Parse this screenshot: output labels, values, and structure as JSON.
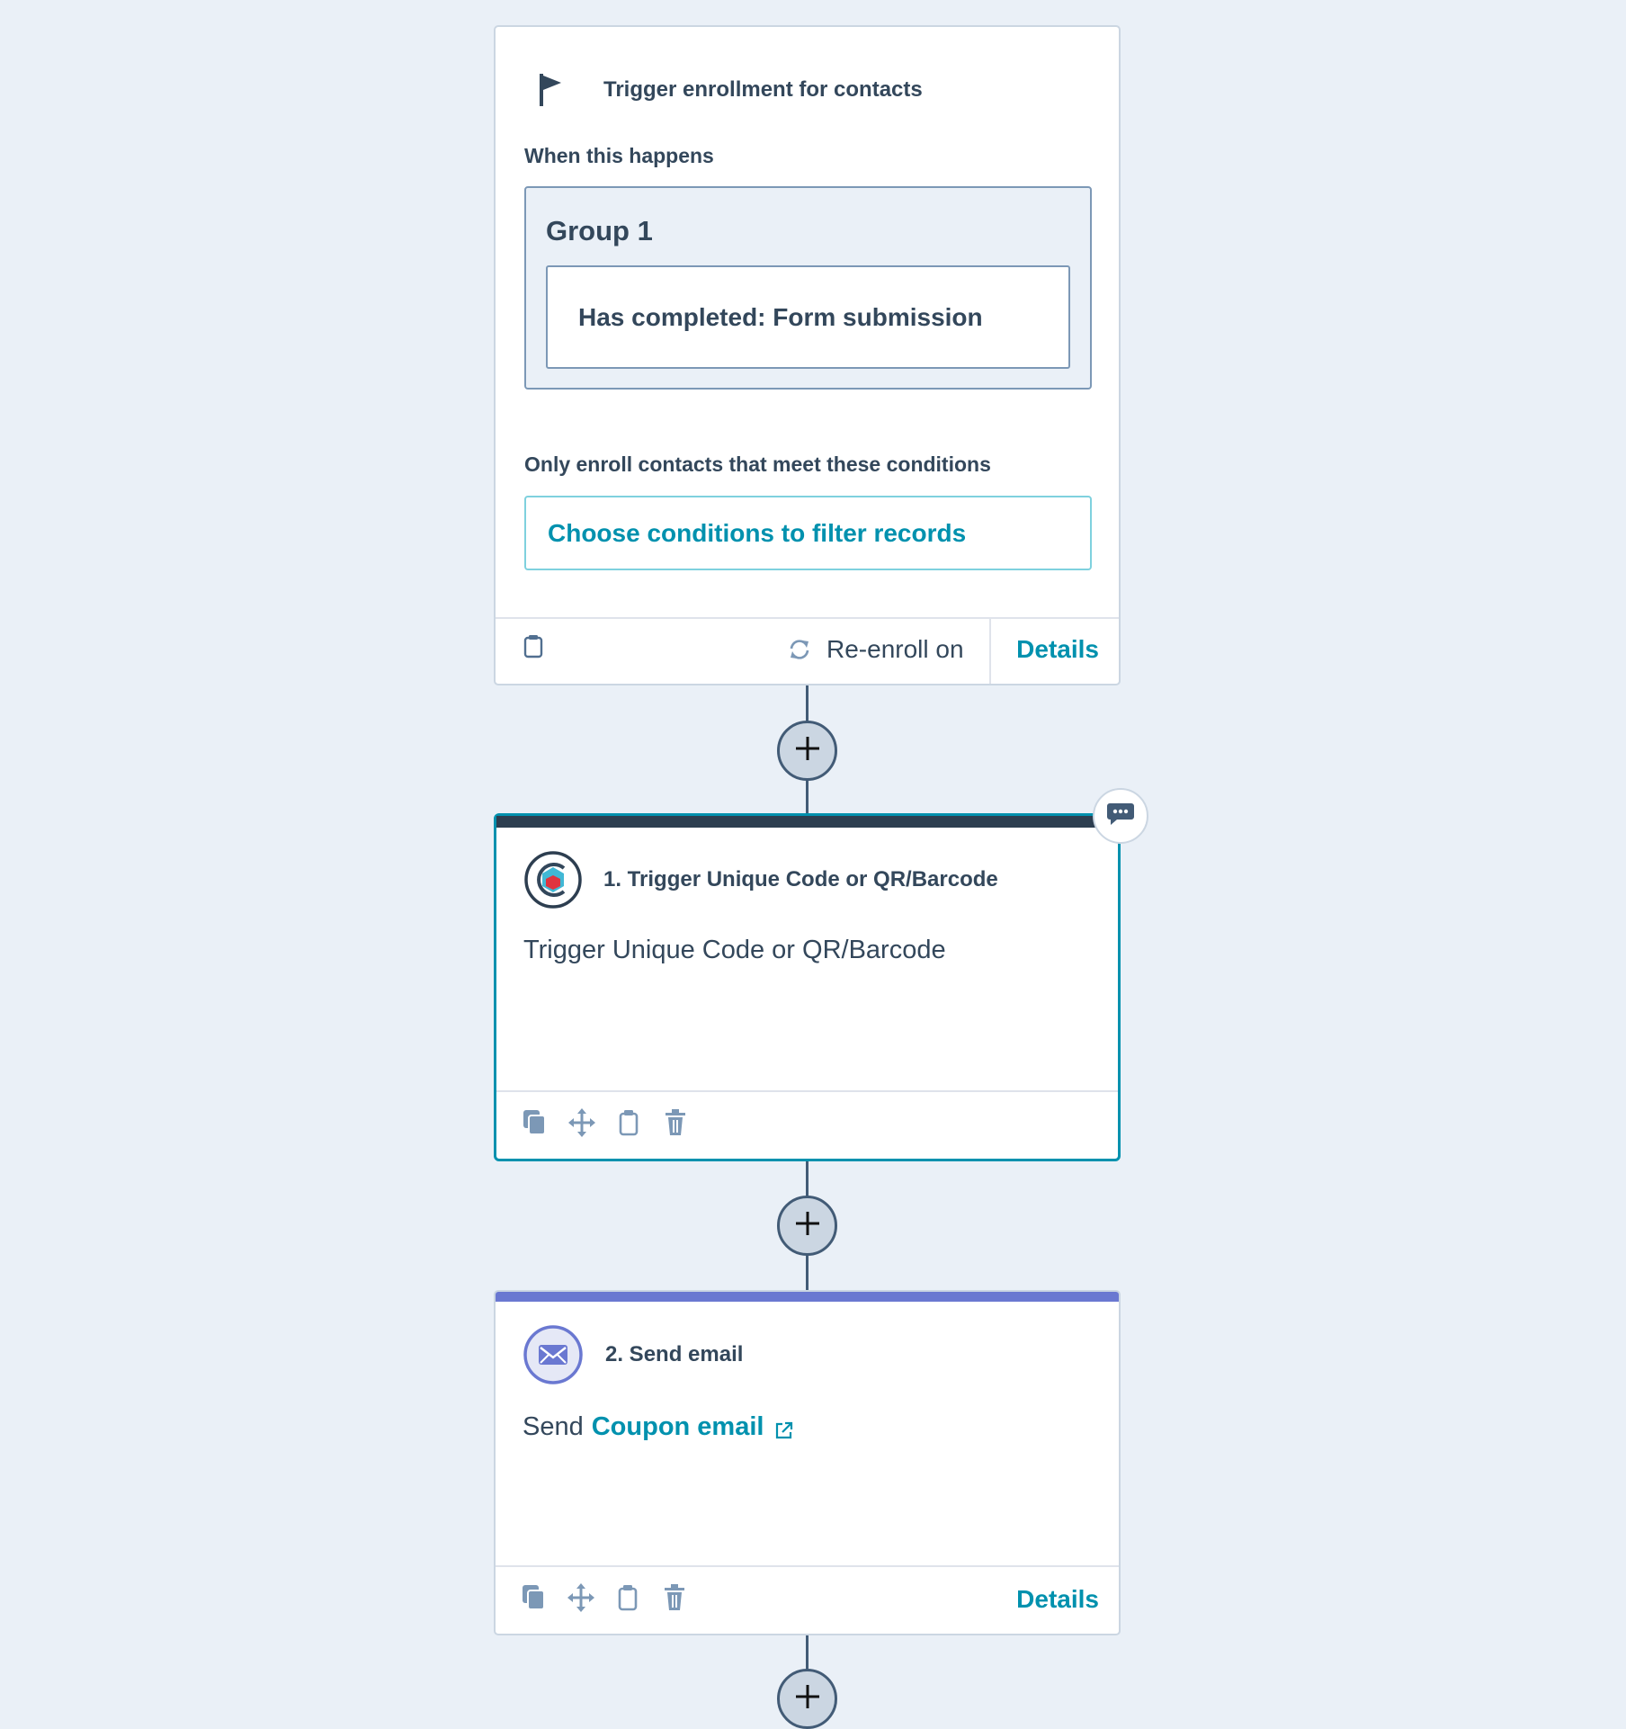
{
  "trigger": {
    "title": "Trigger enrollment for contacts",
    "when_label": "When this happens",
    "group_title": "Group 1",
    "group_condition": "Has completed: Form submission",
    "filter_label": "Only enroll contacts that meet these conditions",
    "filter_button": "Choose conditions to filter records",
    "reenroll_label": "Re-enroll on",
    "details_label": "Details"
  },
  "action1": {
    "title": "1. Trigger Unique Code or QR/Barcode",
    "description": "Trigger Unique Code or QR/Barcode"
  },
  "action2": {
    "title": "2. Send email",
    "description_prefix": "Send",
    "email_link": "Coupon email",
    "details_label": "Details"
  },
  "colors": {
    "accent_teal": "#0091ae",
    "dark_header": "#2d3e50",
    "email_purple": "#6a78d1",
    "canvas_bg": "#eaf0f7"
  }
}
